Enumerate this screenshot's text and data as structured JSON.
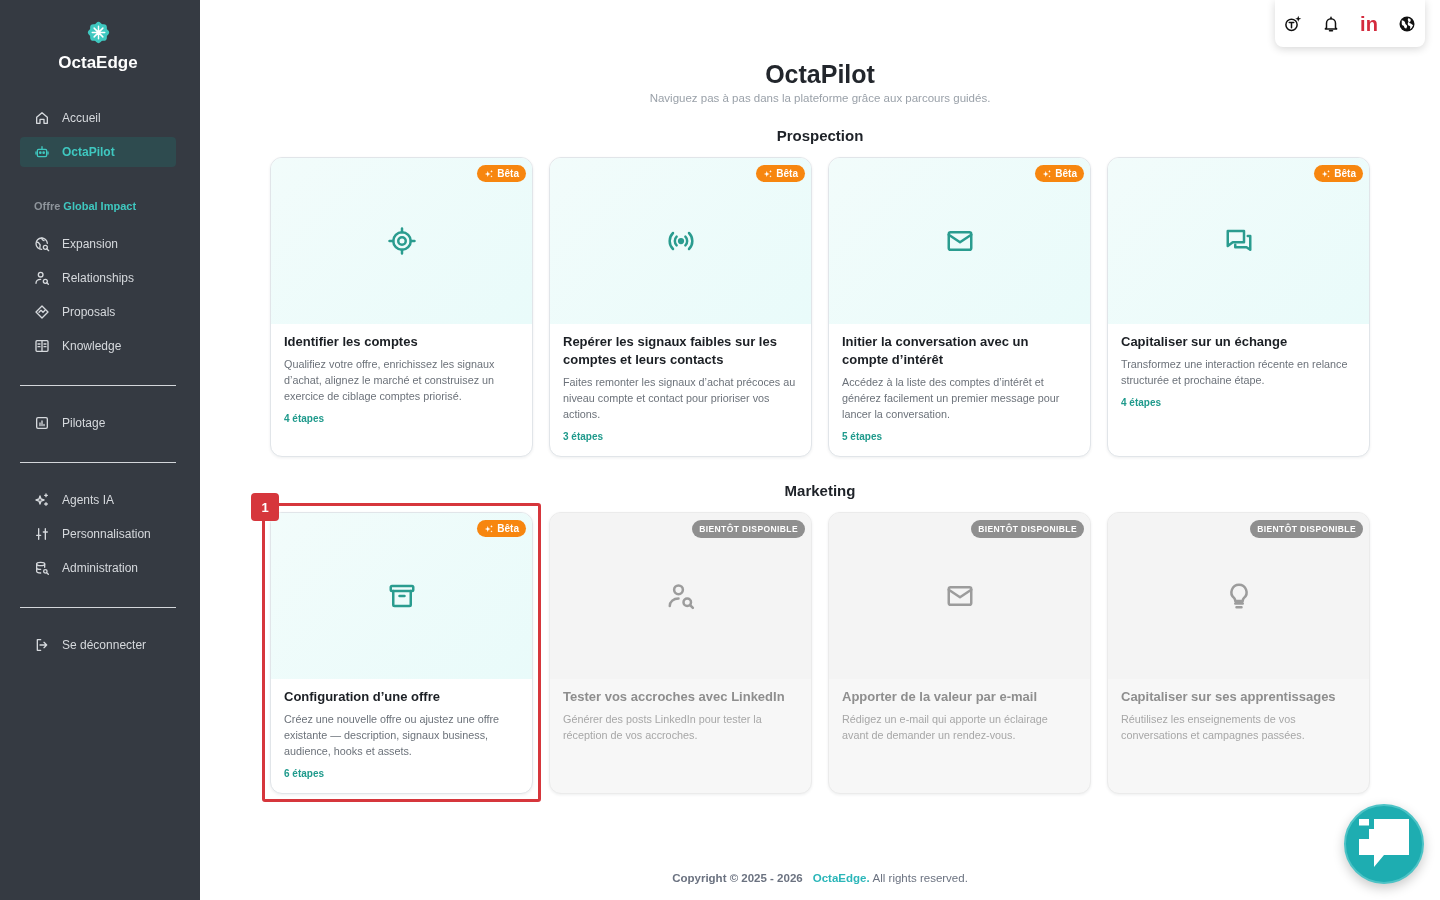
{
  "sidebar": {
    "brand": "OctaEdge",
    "sections": [
      {
        "items": [
          {
            "label": "Accueil",
            "selected": false
          },
          {
            "label": "OctaPilot",
            "selected": true
          }
        ]
      },
      {
        "heading": {
          "prefix": "Offre",
          "name": "Global Impact"
        },
        "items": [
          {
            "label": "Expansion",
            "selected": false
          },
          {
            "label": "Relationships",
            "selected": false
          },
          {
            "label": "Proposals",
            "selected": false
          },
          {
            "label": "Knowledge",
            "selected": false
          }
        ]
      },
      {
        "items": [
          {
            "label": "Pilotage",
            "selected": false
          }
        ]
      },
      {
        "items": [
          {
            "label": "Agents IA",
            "selected": false
          },
          {
            "label": "Personnalisation",
            "selected": false
          },
          {
            "label": "Administration",
            "selected": false
          }
        ]
      },
      {
        "items": [
          {
            "label": "Se déconnecter",
            "selected": false
          }
        ]
      }
    ]
  },
  "toolbar": {
    "linkedin_label": "in"
  },
  "page": {
    "title": "OctaPilot",
    "subtitle": "Naviguez pas à pas dans la plateforme grâce aux parcours guidés."
  },
  "sections": [
    {
      "title": "Prospection",
      "cards": [
        {
          "badge": "Bêta",
          "title": "Identifier les comptes",
          "description": "Qualifiez votre offre, enrichissez les signaux d’achat, alignez le marché et construisez un exercice de ciblage comptes priorisé.",
          "steps": "4 étapes",
          "disabled": false
        },
        {
          "badge": "Bêta",
          "title": "Repérer les signaux faibles sur les comptes et leurs contacts",
          "description": "Faites remonter les signaux d’achat précoces au niveau compte et contact pour prioriser vos actions.",
          "steps": "3 étapes",
          "disabled": false
        },
        {
          "badge": "Bêta",
          "title": "Initier la conversation avec un compte d’intérêt",
          "description": "Accédez à la liste des comptes d’intérêt et générez facilement un premier message pour lancer la conversation.",
          "steps": "5 étapes",
          "disabled": false
        },
        {
          "badge": "Bêta",
          "title": "Capitaliser sur un échange",
          "description": "Transformez une interaction récente en relance structurée et prochaine étape.",
          "steps": "4 étapes",
          "disabled": false
        }
      ]
    },
    {
      "title": "Marketing",
      "cards": [
        {
          "badge": "Bêta",
          "title": "Configuration d’une offre",
          "description": "Créez une nouvelle offre ou ajustez une offre existante — description, signaux business, audience, hooks et assets.",
          "steps": "6 étapes",
          "disabled": false,
          "annotation": "1"
        },
        {
          "badge": "BIENTÔT DISPONIBLE",
          "title": "Tester vos accroches avec LinkedIn",
          "description": "Générer des posts LinkedIn pour tester la réception de vos accroches.",
          "disabled": true
        },
        {
          "badge": "BIENTÔT DISPONIBLE",
          "title": "Apporter de la valeur par e-mail",
          "description": "Rédigez un e-mail qui apporte un éclairage avant de demander un rendez-vous.",
          "disabled": true
        },
        {
          "badge": "BIENTÔT DISPONIBLE",
          "title": "Capitaliser sur ses apprentissages",
          "description": "Réutilisez les enseignements de vos conversations et campagnes passées.",
          "disabled": true
        }
      ]
    }
  ],
  "footer": {
    "copyright": "Copyright © 2025 - 2026",
    "brand_link": "OctaEdge.",
    "rights": "All rights reserved."
  }
}
